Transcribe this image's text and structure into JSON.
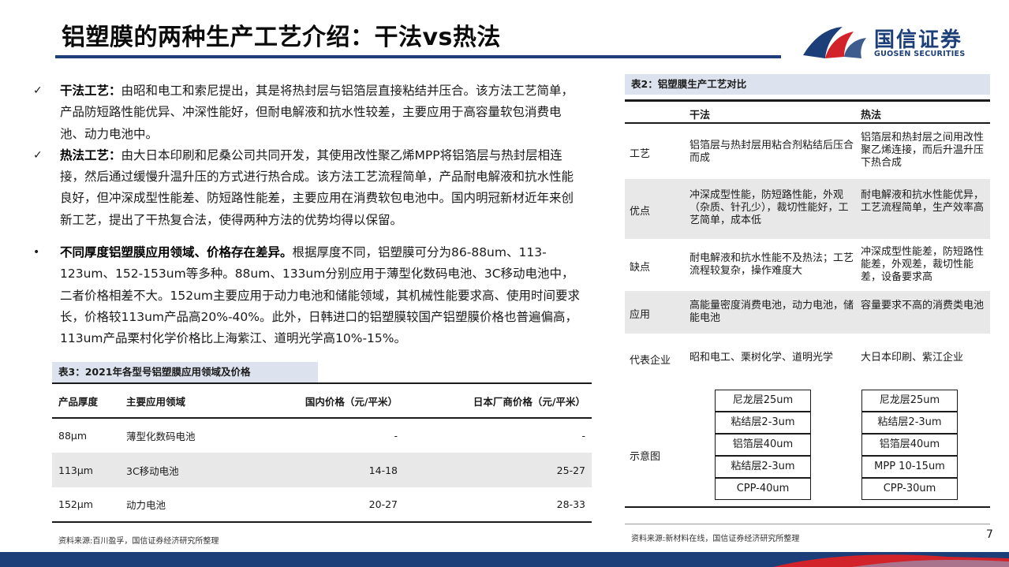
{
  "title": "铝塑膜的两种生产工艺介绍：干法vs热法",
  "logo": {
    "cn": "国信证券",
    "en": "GUOSEN SECURITIES"
  },
  "bullets": [
    {
      "mark": "✓",
      "heading": "干法工艺：",
      "text": "由昭和电工和索尼提出，其是将热封层与铝箔层直接粘结并压合。该方法工艺简单，产品防短路性能优异、冲深性能好，但耐电解液和抗水性较差，主要应用于高容量软包消费电池、动力电池中。"
    },
    {
      "mark": "✓",
      "heading": "热法工艺：",
      "text": "由大日本印刷和尼桑公司共同开发，其使用改性聚乙烯MPP将铝箔层与热封层相连接，然后通过缓慢升温升压的方式进行热合成。该方法工艺流程简单，产品耐电解液和抗水性能良好，但冲深成型性能差、防短路性能差，主要应用在消费软包电池中。国内明冠新材近年来创新工艺，提出了干热复合法，使得两种方法的优势均得以保留。"
    },
    {
      "mark": "•",
      "heading": "不同厚度铝塑膜应用领域、价格存在差异。",
      "text": "根据厚度不同，铝塑膜可分为86-88um、113-123um、152-153um等多种。88um、133um分别应用于薄型化数码电池、3C移动电池中，二者价格相差不大。152um主要应用于动力电池和储能领域，其机械性能要求高、使用时间要求长，价格较113um产品高20%-40%。此外，日韩进口的铝塑膜较国产铝塑膜价格也普遍偏高，113um产品栗村化学价格比上海紫江、道明光学高10%-15%。"
    }
  ],
  "table3": {
    "title": "表3：2021年各型号铝塑膜应用领域及价格",
    "headers": [
      "产品厚度",
      "主要应用领域",
      "国内价格（元/平米）",
      "日本厂商价格（元/平米）"
    ],
    "rows": [
      [
        "88μm",
        "薄型化数码电池",
        "-",
        "-"
      ],
      [
        "113μm",
        "3C移动电池",
        "14-18",
        "25-27"
      ],
      [
        "152μm",
        "动力电池",
        "20-27",
        "28-33"
      ]
    ],
    "source": "资料来源:百川盈孚，国信证券经济研究所整理"
  },
  "table2": {
    "title": "表2：铝塑膜生产工艺对比",
    "headers": [
      "干法",
      "热法"
    ],
    "rows": [
      {
        "label": "工艺",
        "dry": "铝箔层与热封层用粘合剂粘结后压合而成",
        "hot": "铝箔层和热封层之间用改性聚乙烯连接，而后升温升压下热合成"
      },
      {
        "label": "优点",
        "dry": "冲深成型性能，防短路性能，外观（杂质、针孔少），裁切性能好，工艺简单，成本低",
        "hot": "耐电解液和抗水性能优异，工艺流程简单，生产效率高"
      },
      {
        "label": "缺点",
        "dry": "耐电解液和抗水性能不及热法；工艺流程较复杂，操作难度大",
        "hot": "冲深成型性能差，防短路性能差，外观差，裁切性能差，设备要求高"
      },
      {
        "label": "应用",
        "dry": "高能量密度消费电池，动力电池，储能电池",
        "hot": "容量要求不高的消费类电池"
      },
      {
        "label": "代表企业",
        "dry": "昭和电工、栗树化学、道明光学",
        "hot": "大日本印刷、紫江企业"
      },
      {
        "label": "示意图",
        "dry": "",
        "hot": ""
      }
    ],
    "diagram_dry": [
      "尼龙层25um",
      "粘结层2-3um",
      "铝箔层40um",
      "粘结层2-3um",
      "CPP-40um"
    ],
    "diagram_hot": [
      "尼龙层25um",
      "粘结层2-3um",
      "铝箔层40um",
      "MPP 10-15um",
      "CPP-30um"
    ],
    "source": "资料来源:新材料在线，国信证券经济研究所整理"
  },
  "page_number": "7",
  "colors": {
    "brand": "#1c3f7a",
    "accent_red": "#d2232a",
    "header_band": "#dde3ee",
    "row_shade": "#e8e8e8"
  }
}
